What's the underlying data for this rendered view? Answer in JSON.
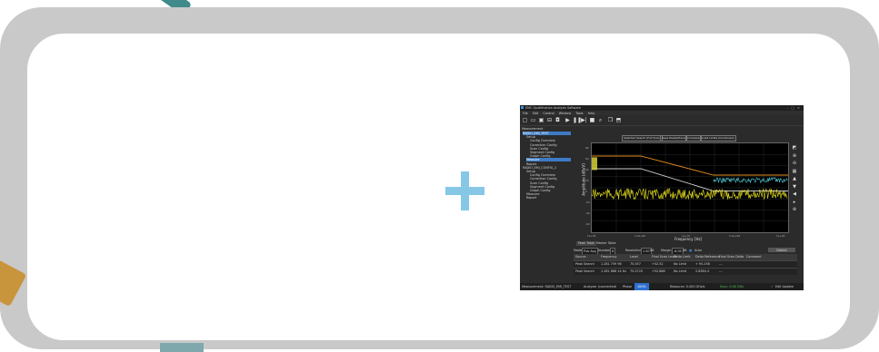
{
  "app": {
    "title": "EMC Qualification Analysis Software",
    "window_controls": "– □ ×",
    "menu": [
      "File",
      "Edit",
      "Control",
      "Window",
      "Tools",
      "Help"
    ],
    "toolbar_icons": [
      "new-file-icon",
      "open-folder-icon",
      "save-icon",
      "print-icon",
      "camera-icon",
      "play-icon",
      "pause-icon",
      "step-icon",
      "stop-icon",
      "search-icon",
      "copy-icon",
      "export-icon"
    ]
  },
  "tree": {
    "header": "Measurement",
    "nodes": [
      {
        "label": "RADIO_EMI_TEST",
        "indent": 0,
        "selected": true
      },
      {
        "label": "Setup",
        "indent": 1,
        "selected": false
      },
      {
        "label": "Config Overview",
        "indent": 2,
        "selected": false
      },
      {
        "label": "Correction Config",
        "indent": 2,
        "selected": false
      },
      {
        "label": "Scan Config",
        "indent": 2,
        "selected": false
      },
      {
        "label": "Segment Config",
        "indent": 2,
        "selected": false
      },
      {
        "label": "Graph Config",
        "indent": 2,
        "selected": false
      },
      {
        "label": "Measure",
        "indent": 1,
        "selected": true
      },
      {
        "label": "Report",
        "indent": 1,
        "selected": false
      },
      {
        "label": "RADIO_EMI_CONFIG_2",
        "indent": 0,
        "selected": false
      },
      {
        "label": "Setup",
        "indent": 1,
        "selected": false
      },
      {
        "label": "Config Overview",
        "indent": 2,
        "selected": false
      },
      {
        "label": "Correction Config",
        "indent": 2,
        "selected": false
      },
      {
        "label": "Scan Config",
        "indent": 2,
        "selected": false
      },
      {
        "label": "Segment Config",
        "indent": 2,
        "selected": false
      },
      {
        "label": "Graph Config",
        "indent": 2,
        "selected": false
      },
      {
        "label": "Measure",
        "indent": 1,
        "selected": false
      },
      {
        "label": "Report",
        "indent": 1,
        "selected": false
      }
    ]
  },
  "plot_buttons": [
    "Selected Search (Full Scan)",
    "Save Peaks/Trace",
    "Compare",
    "Load Limits (Combined)"
  ],
  "chart_data": {
    "type": "line",
    "xlabel": "Frequency [Hz]",
    "ylabel": "Amplitude [dBuV]",
    "x_scale": "log",
    "x_ticks": [
      "1e+05",
      "1.0e+06",
      "1e+07",
      "1.0e+08",
      "1e+09"
    ],
    "y_ticks": [
      "80",
      "60",
      "40",
      "20",
      "0",
      "-20",
      "-40",
      "-60"
    ],
    "series": [
      {
        "color": "#e38a1e",
        "x": [
          100000,
          1000000,
          30000000,
          1000000000
        ],
        "y": [
          60,
          60,
          30,
          30
        ]
      },
      {
        "color": "#cfcfcf",
        "x": [
          100000,
          1000000,
          30000000,
          1000000000
        ],
        "y": [
          40,
          40,
          5,
          5
        ]
      },
      {
        "color": "#52d0e0",
        "x": [
          30000000,
          1000000000
        ],
        "y": [
          22,
          22
        ]
      },
      {
        "color": "#e8e020",
        "x": [
          100000,
          1000000000
        ],
        "y": [
          0,
          0
        ]
      }
    ]
  },
  "bottom": {
    "tabs": [
      "Peak Table",
      "Marker Table"
    ],
    "controls": {
      "mode_label": "Mode",
      "mode_value": "Pub Avg",
      "number_label": "Number",
      "number_value": "8",
      "resolution_label": "Resolution",
      "resolution_value": "1.00",
      "resolution_unit": "dB",
      "margin_label": "Margin",
      "margin_value": "-6.00",
      "margin_unit": "dB",
      "auto_label": "Auto",
      "detect_label": "Detect"
    },
    "table_headers": [
      "Source",
      "Frequency",
      "Level",
      "Final Scan Level",
      "Delta Limit",
      "Delta Reference",
      "Final Scan Delta",
      "Comment"
    ],
    "table_rows": [
      [
        "Peak Search",
        "1.281 759 96",
        "75.057",
        "+52.52",
        "No Limit",
        "+ 95.256",
        "---",
        ""
      ],
      [
        "Peak Search",
        "1.281 868 14 Hz",
        "75.0720",
        "+52.888",
        "No Limit",
        "2.8384 4",
        "---",
        ""
      ]
    ]
  },
  "status": {
    "measurement": "Measurement: RADIO_EMI_TEST",
    "middle": "Analyzer (connected)",
    "phase_label": "Phase",
    "phase_value": "100%",
    "resource": "Resource: 0.000 GHz/s",
    "sync": "Sync: 0.00 GHz",
    "edit_update": "Edit Update"
  }
}
